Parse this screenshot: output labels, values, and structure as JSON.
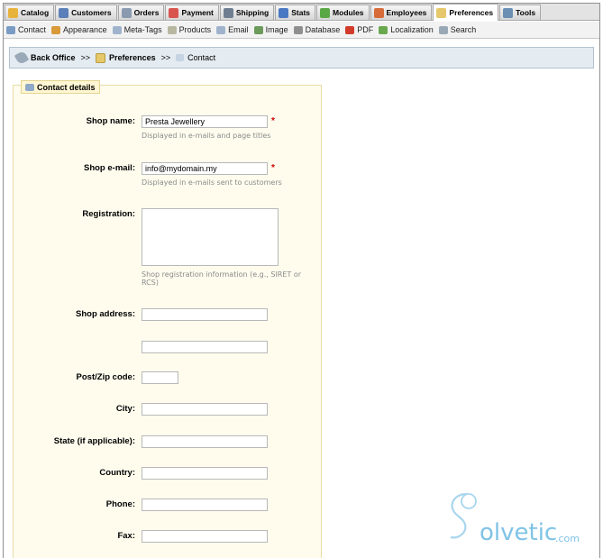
{
  "tabs": [
    {
      "label": "Catalog",
      "icon": "folder-icon",
      "color": "#e8b33a"
    },
    {
      "label": "Customers",
      "icon": "customers-icon",
      "color": "#5b7fb8"
    },
    {
      "label": "Orders",
      "icon": "cart-icon",
      "color": "#8a9bb0"
    },
    {
      "label": "Payment",
      "icon": "payment-icon",
      "color": "#d9534f"
    },
    {
      "label": "Shipping",
      "icon": "truck-icon",
      "color": "#6f7f91"
    },
    {
      "label": "Stats",
      "icon": "stats-icon",
      "color": "#4a78c2"
    },
    {
      "label": "Modules",
      "icon": "puzzle-icon",
      "color": "#5aa845"
    },
    {
      "label": "Employees",
      "icon": "employees-icon",
      "color": "#d86b3a"
    },
    {
      "label": "Preferences",
      "icon": "preferences-icon",
      "color": "#e6c86a"
    },
    {
      "label": "Tools",
      "icon": "wrench-icon",
      "color": "#6b8fb3"
    }
  ],
  "active_tab": "Preferences",
  "subnav": [
    {
      "label": "Contact",
      "icon": "contact-icon",
      "color": "#7a9cc4"
    },
    {
      "label": "Appearance",
      "icon": "appearance-icon",
      "color": "#d99a3a"
    },
    {
      "label": "Meta-Tags",
      "icon": "meta-tags-icon",
      "color": "#9fb4cc"
    },
    {
      "label": "Products",
      "icon": "products-icon",
      "color": "#b7b7a0"
    },
    {
      "label": "Email",
      "icon": "email-icon",
      "color": "#9fb4cc"
    },
    {
      "label": "Image",
      "icon": "image-icon",
      "color": "#6b9a5a"
    },
    {
      "label": "Database",
      "icon": "database-icon",
      "color": "#8f8f8f"
    },
    {
      "label": "PDF",
      "icon": "pdf-icon",
      "color": "#d23b2b"
    },
    {
      "label": "Localization",
      "icon": "localization-icon",
      "color": "#6aa84f"
    },
    {
      "label": "Search",
      "icon": "search-icon",
      "color": "#9aa7b5"
    }
  ],
  "breadcrumb": {
    "icon": "wrench-icon",
    "root": "Back Office",
    "sep1": ">>",
    "section": "Preferences",
    "sep2": ">>",
    "page": "Contact"
  },
  "form": {
    "legend": "Contact details",
    "shop_name": {
      "label": "Shop name:",
      "value": "Presta Jewellery",
      "hint": "Displayed in e-mails and page titles",
      "required": "*"
    },
    "shop_email": {
      "label": "Shop e-mail:",
      "value": "info@mydomain.my",
      "hint": "Displayed in e-mails sent to customers",
      "required": "*"
    },
    "registration": {
      "label": "Registration:",
      "value": "",
      "hint": "Shop registration information (e.g., SIRET or RCS)"
    },
    "shop_address": {
      "label": "Shop address:",
      "value1": "",
      "value2": ""
    },
    "postcode": {
      "label": "Post/Zip code:",
      "value": ""
    },
    "city": {
      "label": "City:",
      "value": ""
    },
    "state": {
      "label": "State (if applicable):",
      "value": ""
    },
    "country": {
      "label": "Country:",
      "value": ""
    },
    "phone": {
      "label": "Phone:",
      "value": ""
    },
    "fax": {
      "label": "Fax:",
      "value": ""
    }
  },
  "watermark": {
    "text": "olvetic",
    "suffix": ".com",
    "color": "#7fc3e6"
  },
  "colors": {
    "crumb_bg": "#e4ebf1",
    "fieldset_bg": "#fffcee",
    "required": "#d40000"
  }
}
